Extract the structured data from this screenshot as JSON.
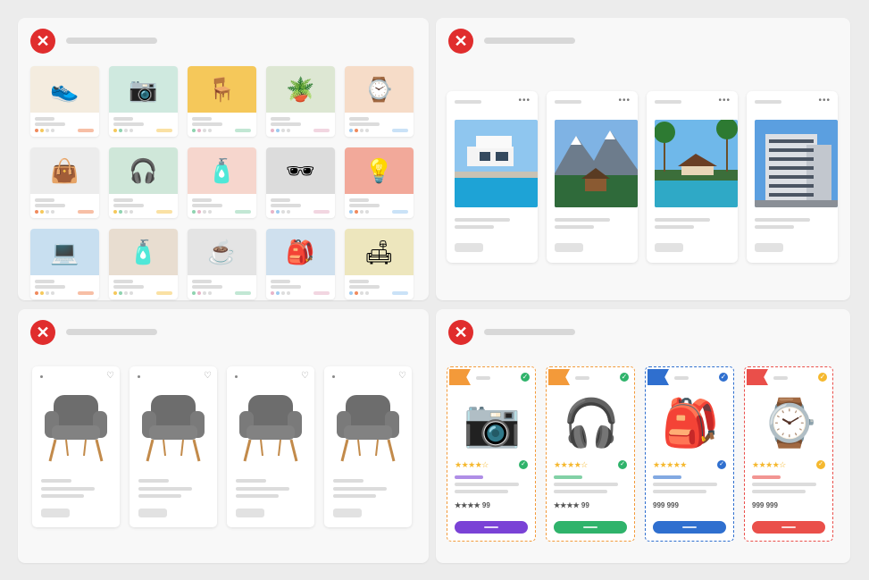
{
  "status_icon": "close-icon",
  "accent_colors": {
    "error": "#e02d2d",
    "purple": "#7a42d6",
    "green": "#2fb36b",
    "blue": "#2f6fcf",
    "red": "#ea4f4a"
  },
  "grid_items": [
    {
      "icon": "sneaker-icon",
      "glyph": "👟",
      "bg": "#f4ecdf"
    },
    {
      "icon": "camera-icon",
      "glyph": "📷",
      "bg": "#cfe9df"
    },
    {
      "icon": "chair-icon",
      "glyph": "🪑",
      "bg": "#f5c85a"
    },
    {
      "icon": "plant-icon",
      "glyph": "🪴",
      "bg": "#dde7d3"
    },
    {
      "icon": "watch-icon",
      "glyph": "⌚",
      "bg": "#f6dcc8"
    },
    {
      "icon": "handbag-icon",
      "glyph": "👜",
      "bg": "#ececec"
    },
    {
      "icon": "headphones-icon",
      "glyph": "🎧",
      "bg": "#cfe7d9"
    },
    {
      "icon": "perfume-icon",
      "glyph": "🧴",
      "bg": "#f6d6cd"
    },
    {
      "icon": "sunglasses-icon",
      "glyph": "🕶",
      "bg": "#dcdcdc"
    },
    {
      "icon": "lamp-icon",
      "glyph": "💡",
      "bg": "#f2a99a"
    },
    {
      "icon": "laptop-icon",
      "glyph": "💻",
      "bg": "#c8dff0"
    },
    {
      "icon": "bottle-icon",
      "glyph": "🧴",
      "bg": "#e8ddd0"
    },
    {
      "icon": "mug-icon",
      "glyph": "☕",
      "bg": "#e4e4e4"
    },
    {
      "icon": "backpack-icon",
      "glyph": "🎒",
      "bg": "#cfe0ee"
    },
    {
      "icon": "pillow-icon",
      "glyph": "🛋",
      "bg": "#ede6bd"
    }
  ],
  "property_cards": [
    {
      "icon": "modern-house-icon",
      "sky": "#8fc6ef",
      "ground": "#1ea3d6"
    },
    {
      "icon": "mountain-cabin-icon",
      "sky": "#7fb3e4",
      "ground": "#2f6a3a"
    },
    {
      "icon": "tropical-resort-icon",
      "sky": "#6fb8ea",
      "ground": "#2fa9c6"
    },
    {
      "icon": "apartment-building-icon",
      "sky": "#5b9fe0",
      "ground": "#8a8f96"
    }
  ],
  "chair_cards": [
    {
      "icon": "armchair-icon",
      "favorite_icon": "heart-icon"
    },
    {
      "icon": "armchair-icon",
      "favorite_icon": "heart-icon"
    },
    {
      "icon": "armchair-icon",
      "favorite_icon": "heart-icon"
    },
    {
      "icon": "armchair-icon",
      "favorite_icon": "heart-icon"
    }
  ],
  "promo_cards": [
    {
      "icon": "camera-icon",
      "glyph": "📷",
      "stars": "★★★★☆",
      "price": "★★★★ 99",
      "accent": "#7a42d6",
      "ribbon": "#f39a3a",
      "badge": "#2fb36b"
    },
    {
      "icon": "headphones-icon",
      "glyph": "🎧",
      "stars": "★★★★☆",
      "price": "★★★★ 99",
      "accent": "#2fb36b",
      "ribbon": "#f39a3a",
      "badge": "#2fb36b"
    },
    {
      "icon": "backpack-icon",
      "glyph": "🎒",
      "stars": "★★★★★",
      "price": "999 999",
      "accent": "#2f6fcf",
      "ribbon": "#2f6fcf",
      "badge": "#2f6fcf"
    },
    {
      "icon": "watch-icon",
      "glyph": "⌚",
      "stars": "★★★★☆",
      "price": "999 999",
      "accent": "#ea4f4a",
      "ribbon": "#ea4f4a",
      "badge": "#f5b82e"
    }
  ]
}
